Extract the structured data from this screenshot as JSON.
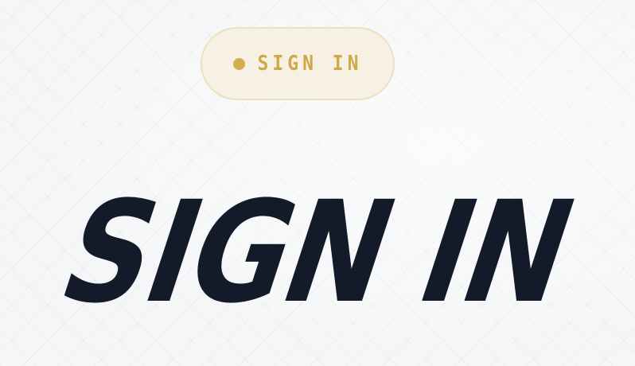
{
  "badge": {
    "label": "SIGN IN"
  },
  "hero": {
    "title": "SIGN IN"
  },
  "colors": {
    "background": "#f5f6f7",
    "title": "#131a29",
    "badge_background": "#f6f1e2",
    "badge_border": "#ece1bf",
    "accent_gold": "#d4ae4e"
  }
}
